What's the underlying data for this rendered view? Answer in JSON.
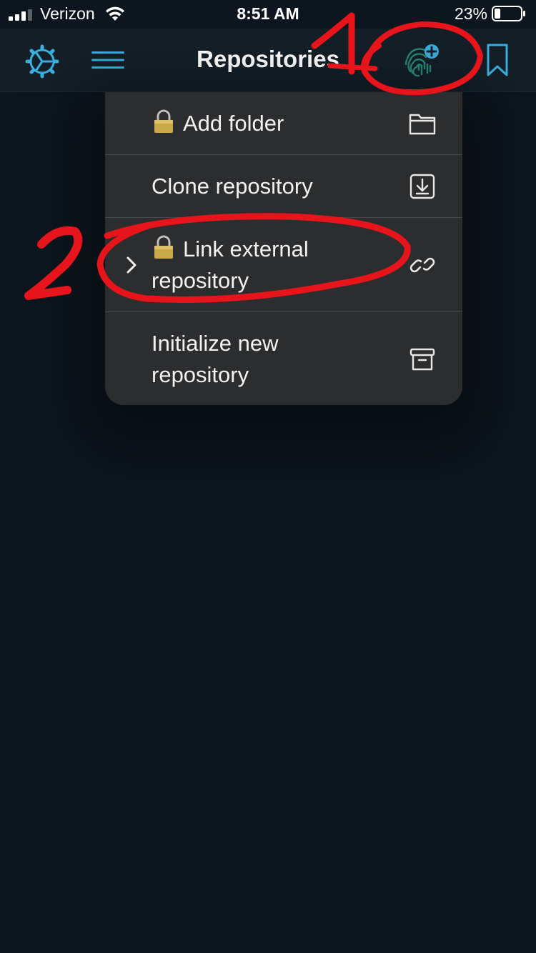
{
  "status_bar": {
    "carrier": "Verizon",
    "time": "8:51 AM",
    "battery_percent": "23%",
    "battery_level": 0.23
  },
  "nav_bar": {
    "title": "Repositories",
    "accent_color": "#3ab0e0"
  },
  "menu": {
    "items": [
      {
        "label": "Add folder",
        "locked": true,
        "icon": "folder-icon"
      },
      {
        "label": "Clone repository",
        "locked": false,
        "icon": "download-icon"
      },
      {
        "label_line1": "Link external",
        "label_line2": "repository",
        "locked": true,
        "icon": "link-icon",
        "has_submenu": true
      },
      {
        "label_line1": "Initialize new",
        "label_line2": "repository",
        "locked": false,
        "icon": "archive-icon"
      }
    ]
  },
  "annotations": {
    "marker_1": "1",
    "marker_2": "2",
    "color": "#e8141c"
  }
}
